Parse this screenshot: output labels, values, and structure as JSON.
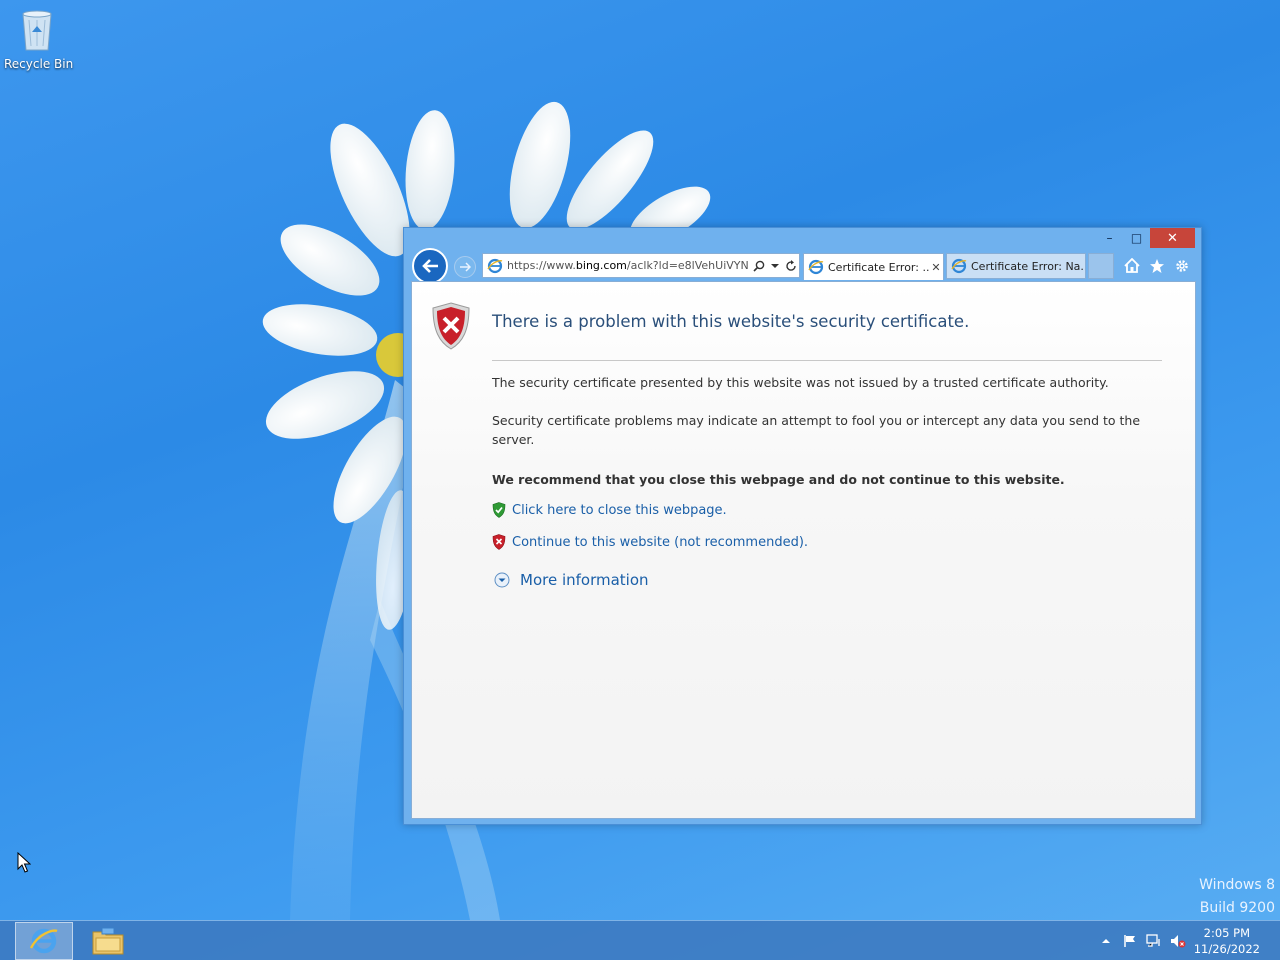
{
  "desktop": {
    "icons": [
      {
        "label": "Recycle Bin",
        "icon": "recycle-bin-icon"
      }
    ],
    "watermark": {
      "line1": "Windows 8",
      "line2": "Build 9200"
    }
  },
  "browser": {
    "window_buttons": {
      "minimize": "–",
      "maximize": "□",
      "close": "✕"
    },
    "address": {
      "url_prefix": "https://www.",
      "url_domain": "bing.com",
      "url_suffix": "/aclk?ld=e8lVehUiVYN"
    },
    "tabs": [
      {
        "label": "Certificate Error: ...",
        "active": true,
        "close": "✕"
      },
      {
        "label": "Certificate Error: Na...",
        "active": false
      }
    ],
    "page": {
      "title": "There is a problem with this website's security certificate.",
      "paragraph1": "The security certificate presented by this website was not issued by a trusted certificate authority.",
      "paragraph2": "Security certificate problems may indicate an attempt to fool you or intercept any data you send to the server.",
      "recommendation": "We recommend that you close this webpage and do not continue to this website.",
      "close_link": "Click here to close this webpage.",
      "continue_link": "Continue to this website (not recommended).",
      "more_info": "More information"
    }
  },
  "taskbar": {
    "clock": {
      "time": "2:05 PM",
      "date": "11/26/2022"
    }
  },
  "colors": {
    "desktop_bg": "#2c8ae6",
    "link": "#1a5fa8",
    "title": "#2a4f7a",
    "close_button": "#c7453a"
  }
}
